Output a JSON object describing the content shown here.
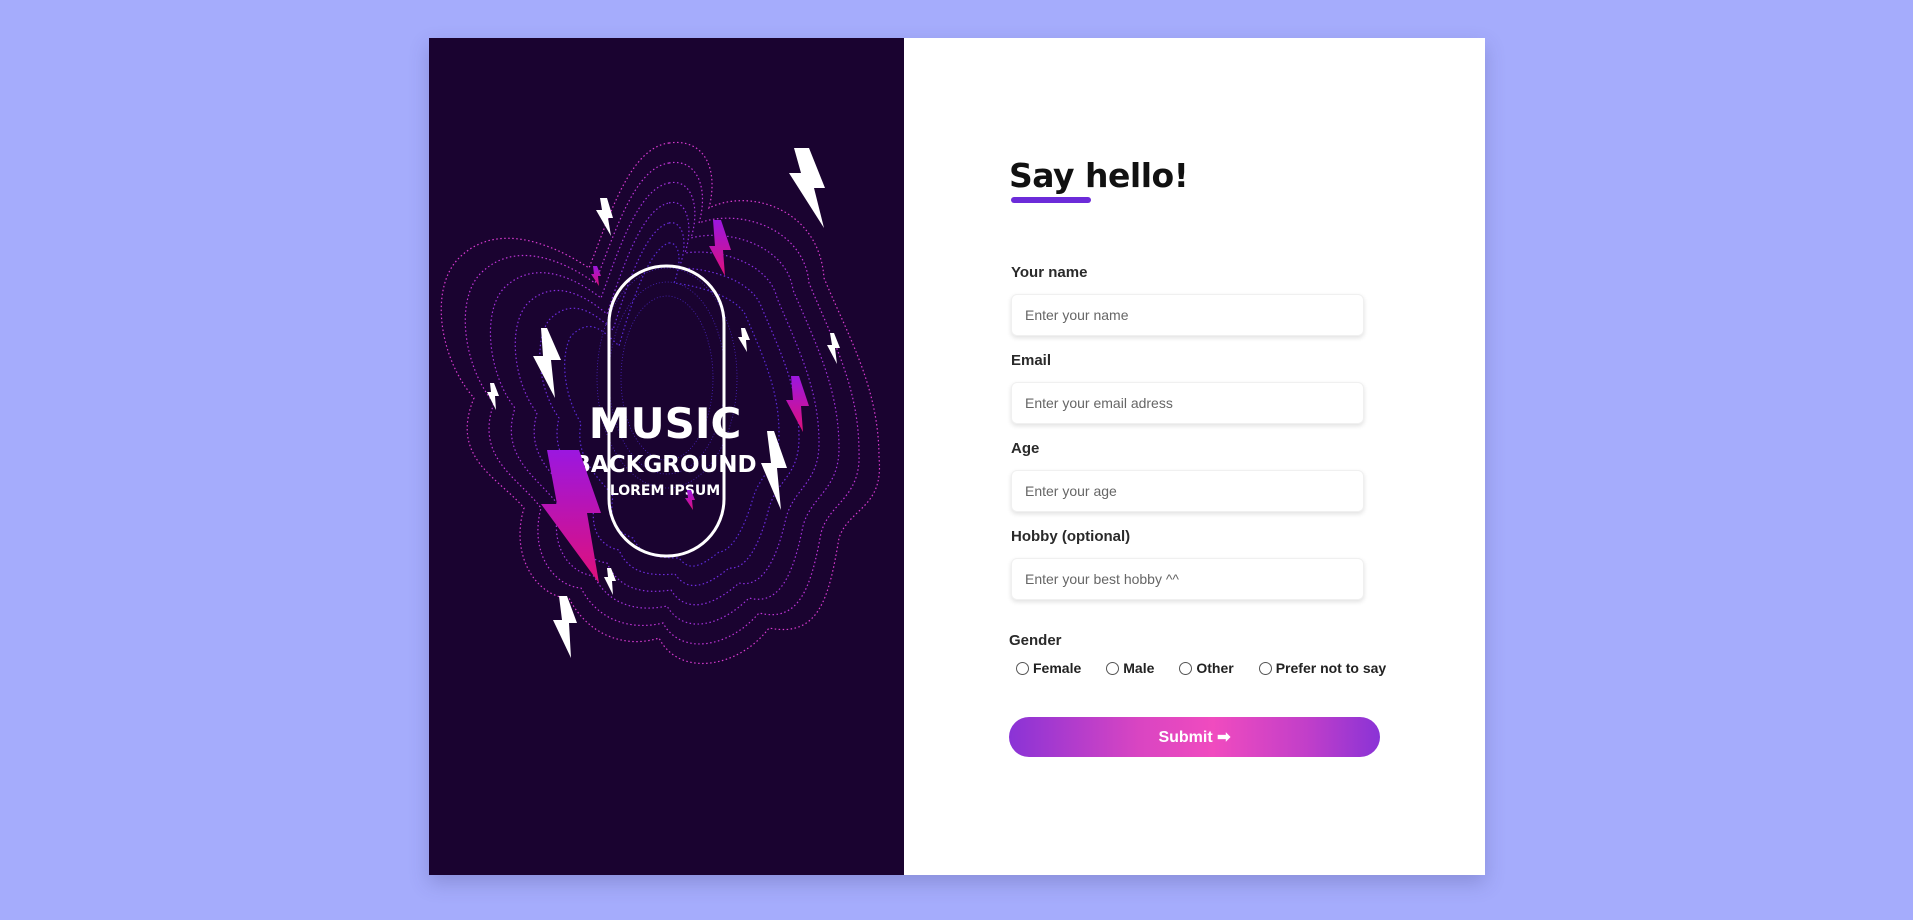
{
  "art": {
    "title": "MUSIC",
    "subtitle": "BACKGROUND",
    "tagline": "LOREM IPSUM"
  },
  "form": {
    "heading": "Say hello!",
    "fields": [
      {
        "label": "Your name",
        "placeholder": "Enter your name"
      },
      {
        "label": "Email",
        "placeholder": "Enter your email adress"
      },
      {
        "label": "Age",
        "placeholder": "Enter your age"
      },
      {
        "label": "Hobby (optional)",
        "placeholder": "Enter your best hobby ^^"
      }
    ],
    "gender": {
      "label": "Gender",
      "options": [
        "Female",
        "Male",
        "Other",
        "Prefer not to say"
      ]
    },
    "submit_label": "Submit ➡"
  },
  "colors": {
    "page_bg": "#a5acfc",
    "art_bg": "#1a0330",
    "accent": "#6c2bd9",
    "button_gradient_mid": "#f04bbf"
  }
}
